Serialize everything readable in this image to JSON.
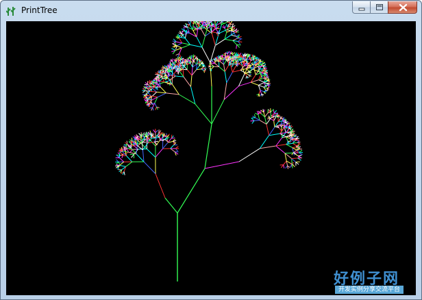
{
  "window": {
    "title": "PrintTree",
    "app_icon": "tree-icon",
    "buttons": {
      "minimize": "minimize-icon",
      "maximize": "maximize-icon",
      "close": "close-icon"
    }
  },
  "canvas": {
    "background": "#000000",
    "trunk_color": "#33ff55",
    "branch_colors": [
      "#ff33ff",
      "#ffff55",
      "#00ffff",
      "#ff3333",
      "#33ff55",
      "#ffaaaa",
      "#ffffff",
      "#4466ff"
    ]
  },
  "watermark": {
    "main": "好例子网",
    "sub": "开发实例分享交流平台"
  }
}
